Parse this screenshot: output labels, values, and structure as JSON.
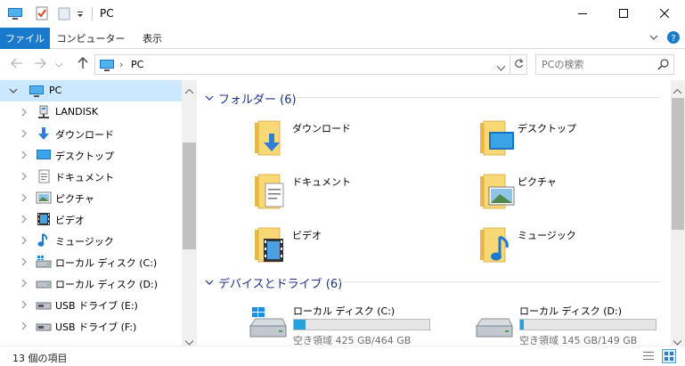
{
  "window": {
    "title": "PC",
    "quick_access": [
      "properties-icon",
      "new-folder-icon",
      "customize-dropdown-icon"
    ],
    "controls": [
      "minimize-icon",
      "maximize-icon",
      "close-icon"
    ]
  },
  "ribbon": {
    "tabs": [
      {
        "label": "ファイル",
        "active": true
      },
      {
        "label": "コンピューター",
        "active": false
      },
      {
        "label": "表示",
        "active": false
      }
    ],
    "accent": "#1979ca"
  },
  "address": {
    "crumb": "PC",
    "search_placeholder": "PCの検索"
  },
  "nav": {
    "items": [
      {
        "label": "PC",
        "icon": "pc-icon",
        "selected": true,
        "expanded": true
      },
      {
        "label": "LANDISK",
        "icon": "network-drive-icon"
      },
      {
        "label": "ダウンロード",
        "icon": "download-icon"
      },
      {
        "label": "デスクトップ",
        "icon": "desktop-icon"
      },
      {
        "label": "ドキュメント",
        "icon": "documents-icon"
      },
      {
        "label": "ピクチャ",
        "icon": "pictures-icon"
      },
      {
        "label": "ビデオ",
        "icon": "videos-icon"
      },
      {
        "label": "ミュージック",
        "icon": "music-icon"
      },
      {
        "label": "ローカル ディスク (C:)",
        "icon": "windows-drive-icon"
      },
      {
        "label": "ローカル ディスク (D:)",
        "icon": "hard-drive-icon"
      },
      {
        "label": "USB ドライブ (E:)",
        "icon": "usb-drive-icon"
      },
      {
        "label": "USB ドライブ (F:)",
        "icon": "usb-drive-icon"
      }
    ]
  },
  "content": {
    "folders_header": "フォルダー (6)",
    "folders": [
      {
        "label": "ダウンロード",
        "overlay": "download-icon"
      },
      {
        "label": "デスクトップ",
        "overlay": "desktop-icon"
      },
      {
        "label": "ドキュメント",
        "overlay": "documents-icon"
      },
      {
        "label": "ピクチャ",
        "overlay": "pictures-icon"
      },
      {
        "label": "ビデオ",
        "overlay": "videos-icon"
      },
      {
        "label": "ミュージック",
        "overlay": "music-icon"
      }
    ],
    "drives_header": "デバイスとドライブ (6)",
    "drives": [
      {
        "label": "ローカル ディスク (C:)",
        "free_text": "空き領域 425 GB/464 GB",
        "used_fraction": 0.084,
        "icon": "windows-drive-icon"
      },
      {
        "label": "ローカル ディスク (D:)",
        "free_text": "空き領域 145 GB/149 GB",
        "used_fraction": 0.027,
        "icon": "hard-drive-icon"
      }
    ]
  },
  "status": {
    "count_text": "13 個の項目"
  },
  "colors": {
    "selection": "#cce8ff",
    "group_header": "#1e3287",
    "drive_bar": "#26a0da",
    "folder": "#f8d775"
  }
}
